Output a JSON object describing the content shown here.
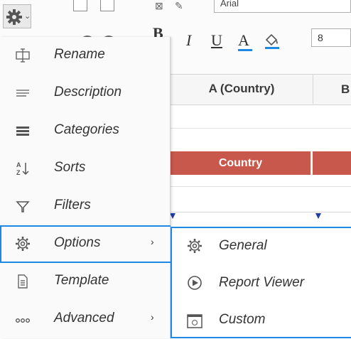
{
  "toolbar": {
    "font_name": "Arial",
    "font_size": "8",
    "bold_label": "B",
    "italic_label": "I",
    "underline_label": "U",
    "font_color_label": "A"
  },
  "grid": {
    "column_a_header": "A (Country)",
    "column_b_header": "B",
    "country_header": "Country"
  },
  "menu": {
    "items": [
      {
        "label": "Rename",
        "icon": "rename-icon"
      },
      {
        "label": "Description",
        "icon": "description-icon"
      },
      {
        "label": "Categories",
        "icon": "categories-icon"
      },
      {
        "label": "Sorts",
        "icon": "sort-icon"
      },
      {
        "label": "Filters",
        "icon": "filter-icon"
      },
      {
        "label": "Options",
        "icon": "gear-icon",
        "has_submenu": true,
        "active": true
      },
      {
        "label": "Template",
        "icon": "template-icon"
      },
      {
        "label": "Advanced",
        "icon": "more-icon",
        "has_submenu": true
      }
    ]
  },
  "submenu": {
    "items": [
      {
        "label": "General",
        "icon": "gear-icon"
      },
      {
        "label": "Report Viewer",
        "icon": "play-circle-icon"
      },
      {
        "label": "Custom",
        "icon": "window-icon"
      }
    ]
  },
  "colors": {
    "accent": "#1e88e5",
    "header_fill": "#c8574c"
  }
}
